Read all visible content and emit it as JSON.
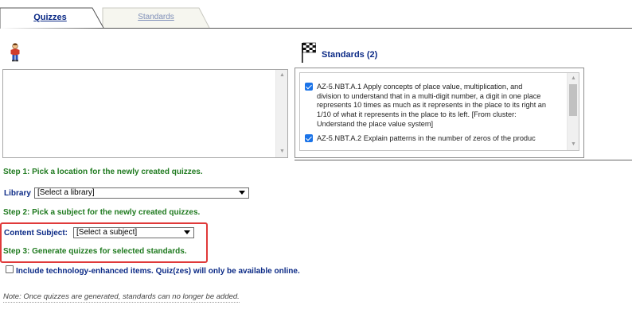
{
  "tabs": {
    "quizzes_label": "Quizzes",
    "standards_label": "Standards"
  },
  "standards_panel": {
    "title": "Standards (2)",
    "items": [
      {
        "checked": true,
        "lines": [
          "AZ-5.NBT.A.1 Apply concepts of place value, multiplication, and",
          "division to understand that in a multi-digit number, a digit in one place",
          "represents 10 times as much as it represents in the place to its right an",
          "1/10 of what it represents in the place to its left. [From cluster:",
          "Understand the place value system]"
        ]
      },
      {
        "checked": true,
        "lines": [
          "AZ-5.NBT.A.2 Explain patterns in the number of zeros of the produc"
        ]
      }
    ]
  },
  "steps": {
    "step1": "Step 1:  Pick a location for the newly created quizzes.",
    "step2": "Step 2:  Pick a subject for the newly created quizzes.",
    "step3": "Step 3:  Generate quizzes for selected standards."
  },
  "library": {
    "label": "Library",
    "value": "[Select a library]"
  },
  "content_subject": {
    "label": "Content Subject:",
    "value": "[Select a subject]"
  },
  "tech_enhanced": {
    "checked": false,
    "label": "Include technology-enhanced items. Quiz(zes) will only be available online."
  },
  "note": "Note: Once quizzes are generated, standards can no longer be added.",
  "colors": {
    "highlight_border": "#e03a3a",
    "step_text": "#1f7a1f",
    "label_text": "#0b2a86",
    "checkbox_checked": "#1a73e8"
  },
  "icons": {
    "library": "person-icon",
    "standards": "checkered-flag-icon"
  }
}
